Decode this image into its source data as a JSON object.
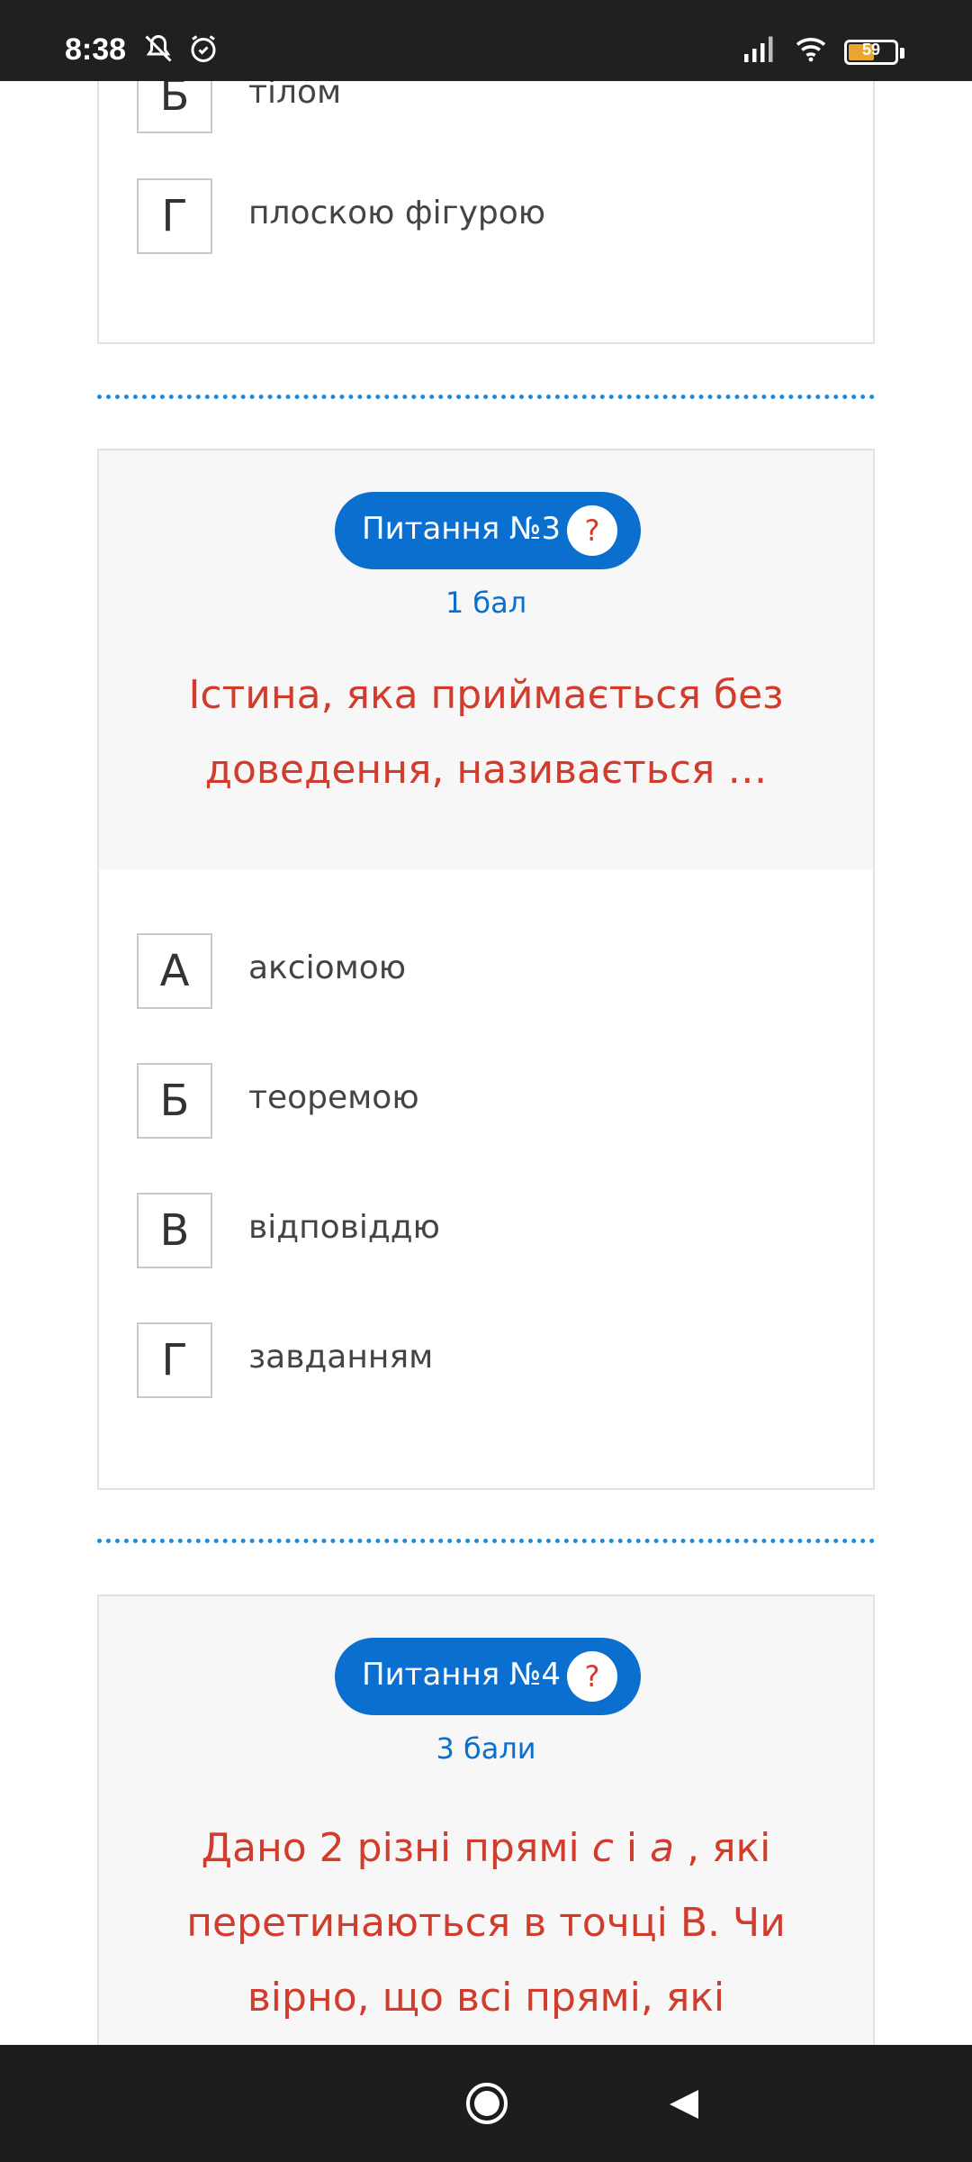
{
  "status_bar": {
    "time": "8:38",
    "battery": "59",
    "icons": [
      "bell-off-icon",
      "alarm-icon",
      "signal-icon",
      "wifi-icon",
      "battery-icon"
    ]
  },
  "previous_question": {
    "answers": [
      {
        "letter": "Б",
        "text": "тілом"
      },
      {
        "letter": "Г",
        "text": "плоскою фігурою"
      }
    ]
  },
  "question3": {
    "label": "Питання №3",
    "help": "?",
    "points": "1 бал",
    "text_line1": "Істина, яка приймається без",
    "text_line2": "доведення, називається …",
    "answers": [
      {
        "letter": "А",
        "text": "аксіомою"
      },
      {
        "letter": "Б",
        "text": "теоремою"
      },
      {
        "letter": "В",
        "text": "відповіддю"
      },
      {
        "letter": "Г",
        "text": "завданням"
      }
    ]
  },
  "question4": {
    "label": "Питання №4",
    "help": "?",
    "points": "3 бали",
    "text_line1_a": "Дано 2 різні прямі ",
    "var_c": "c",
    "and": " і ",
    "var_a": "a",
    "text_line1_b": " , які",
    "text_line2": "перетинаються в точці В. Чи",
    "text_line3": "вірно, що всі прямі, які"
  },
  "colors": {
    "accent_blue": "#0a6fcf",
    "question_red": "#d13c2c",
    "divider_blue": "#1f8ad6"
  }
}
